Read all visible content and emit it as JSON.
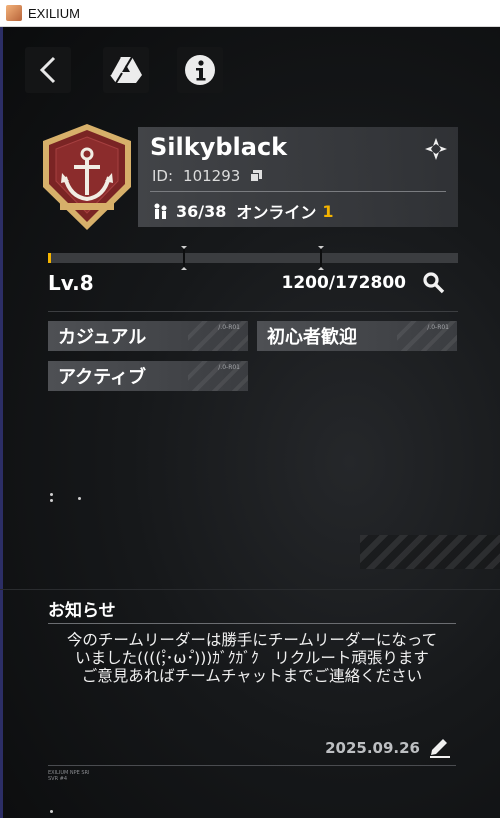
{
  "window": {
    "title": "EXILIUM",
    "app_icon": "exilium-app-icon"
  },
  "toolbar": {
    "back_icon": "chevron-left-icon",
    "drive_icon": "drive-icon",
    "info_icon": "info-icon"
  },
  "team": {
    "name": "Silkyblack",
    "id_label": "ID:",
    "id_value": "101293",
    "members_current": "36",
    "members_separator": "/",
    "members_max": "38",
    "online_label": "オンライン",
    "online_count": "1",
    "emblem": "anchor-shield-emblem"
  },
  "progress": {
    "level": "Lv.8",
    "exp_text": "1200/172800",
    "exp_fraction": 0.007
  },
  "tags": [
    {
      "label": "カジュアル",
      "code": "/.0-R01"
    },
    {
      "label": "初心者歓迎",
      "code": "/.0-R01"
    },
    {
      "label": "アクティブ",
      "code": "/.0-R01"
    }
  ],
  "notice": {
    "title": "お知らせ",
    "body": "今のチームリーダーは勝手にチームリーダーになって\nいました((((;゚･ω･゚)))ｶﾞｸｶﾞｸ　リクルート頑張ります\nご意見あればチームチャットまでご連絡ください",
    "date": "2025.09.26"
  },
  "footer": {
    "code_line1": "EXILIUM NPE SRI",
    "code_line2": "SVR #4"
  },
  "colors": {
    "accent": "#f5b400",
    "panel": "#46484c",
    "background": "#0d0e0f",
    "emblem_red": "#7a2424"
  }
}
